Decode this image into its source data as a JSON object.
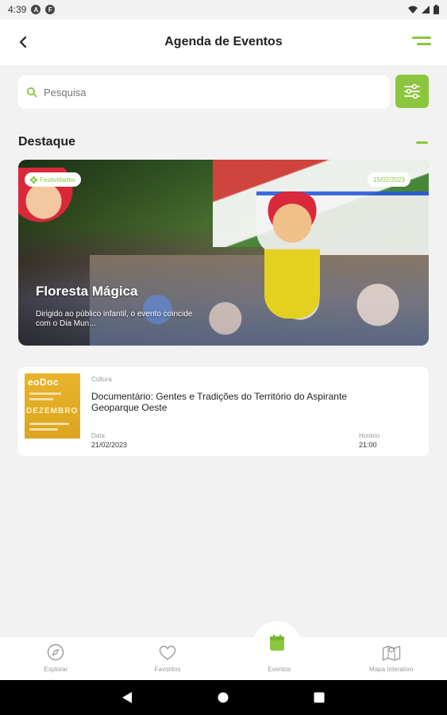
{
  "status_bar": {
    "time": "4:39",
    "icon_a": "A",
    "icon_b": "F"
  },
  "header": {
    "title": "Agenda de Eventos"
  },
  "search": {
    "placeholder": "Pesquisa"
  },
  "section": {
    "title": "Destaque"
  },
  "featured": {
    "category": "Festividades",
    "date": "15/02/2023",
    "title": "Floresta Mágica",
    "description": "Dirigido ao público infantil, o evento coincide com o Dia Mun..."
  },
  "events": [
    {
      "category": "Cultura",
      "title": "Documentário: Gentes e Tradições do Território do Aspirante Geoparque Oeste",
      "date_label": "Data",
      "date": "21/02/2023",
      "time_label": "Horário",
      "time": "21:00",
      "thumb_title": "eoDoc",
      "thumb_month": "DEZEMBRO"
    }
  ],
  "bottom_nav": [
    {
      "label": "Explorar",
      "icon": "compass-icon"
    },
    {
      "label": "Favoritos",
      "icon": "heart-icon"
    },
    {
      "label": "Eventos",
      "icon": "calendar-icon"
    },
    {
      "label": "Mapa Interativo",
      "icon": "map-icon"
    }
  ],
  "colors": {
    "accent": "#8cc63f",
    "background": "#f2f2f2"
  }
}
